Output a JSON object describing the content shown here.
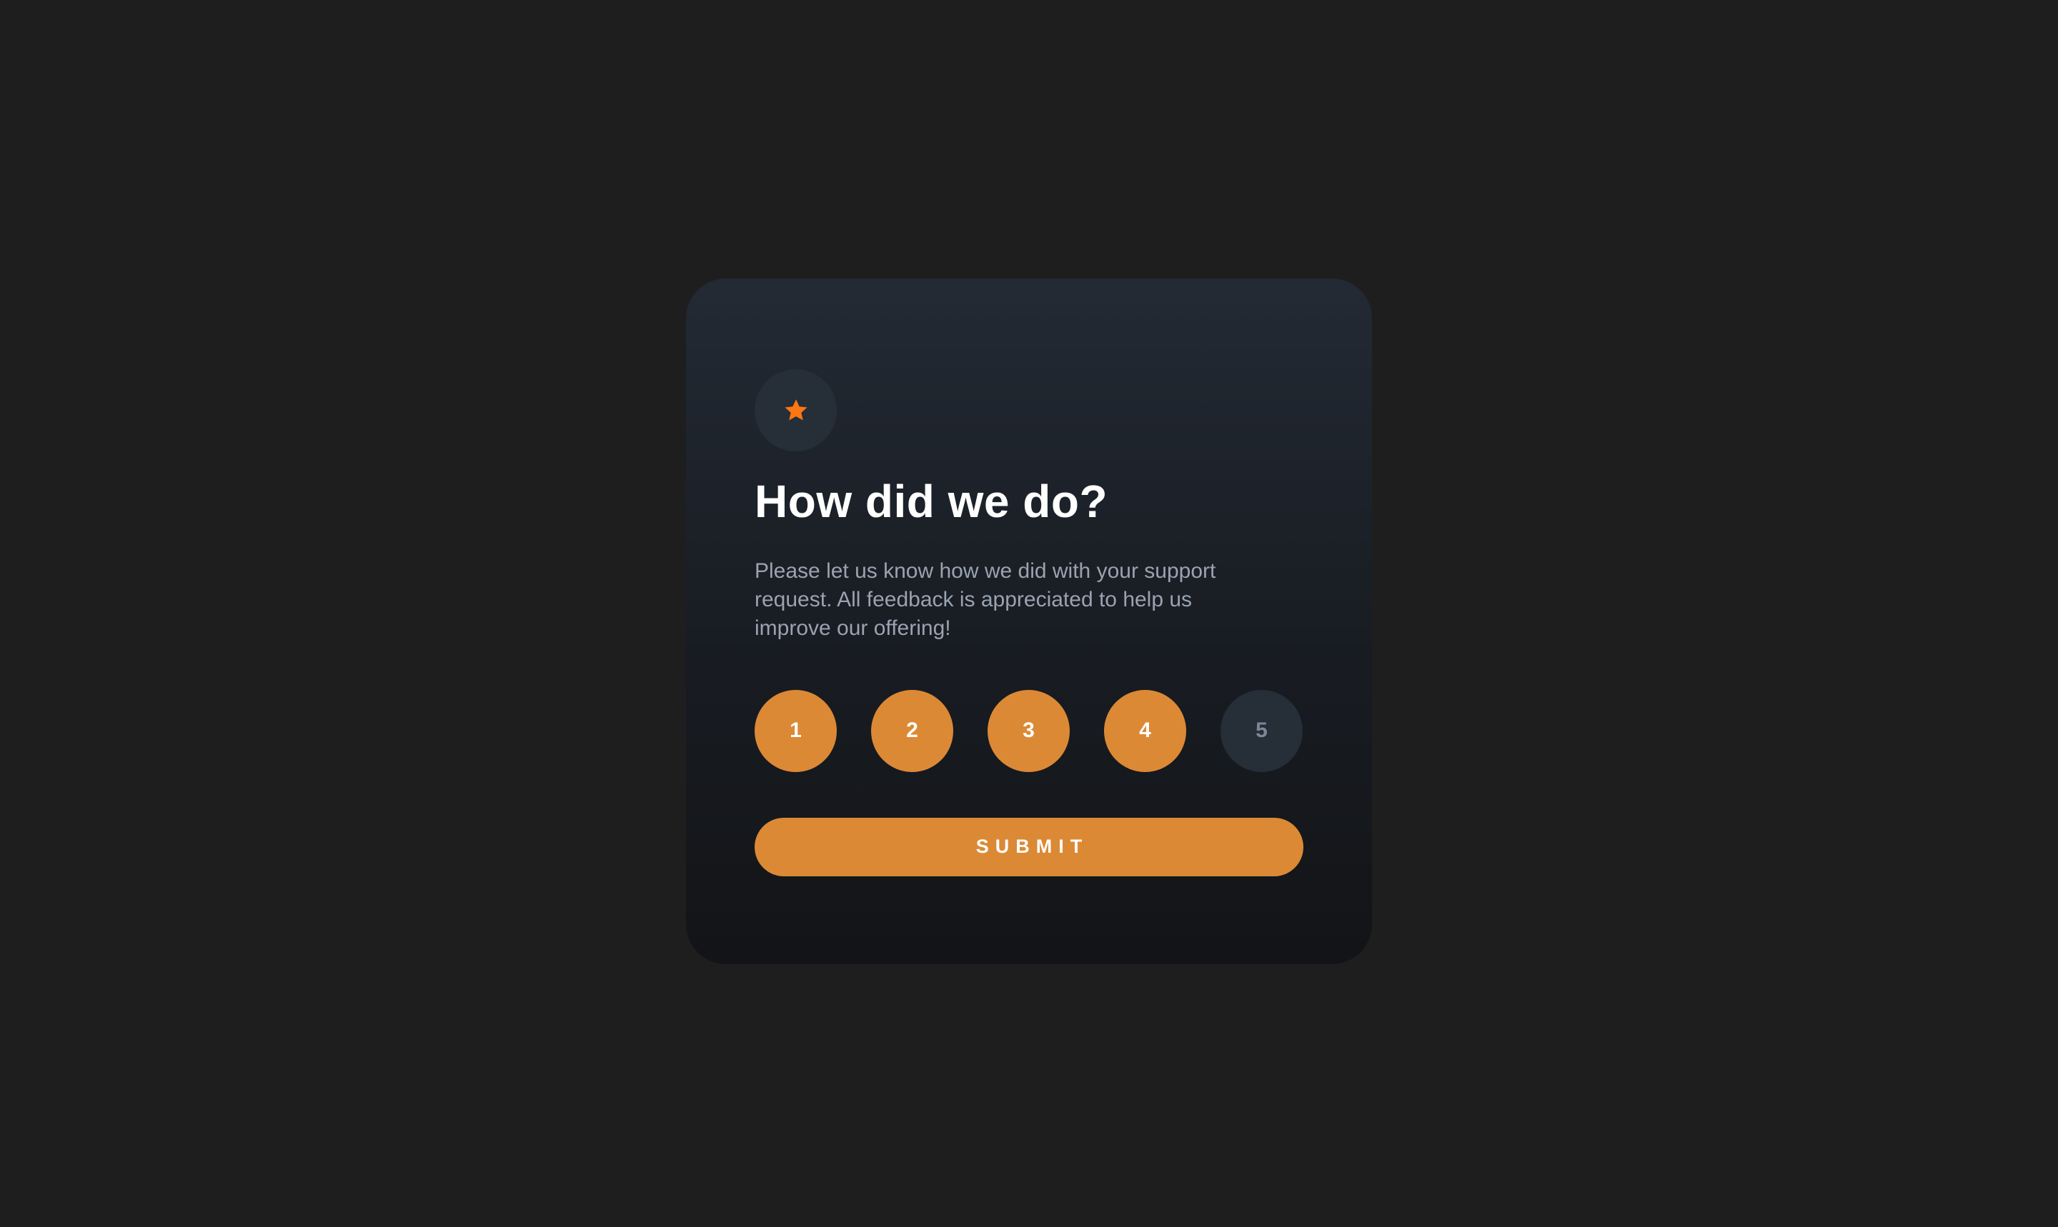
{
  "card": {
    "icon": "star-icon",
    "title": "How did we do?",
    "description": "Please let us know how we did with your support request. All feedback is appreciated to help us improve our offering!"
  },
  "ratings": [
    {
      "label": "1",
      "state": "active"
    },
    {
      "label": "2",
      "state": "active"
    },
    {
      "label": "3",
      "state": "active"
    },
    {
      "label": "4",
      "state": "active"
    },
    {
      "label": "5",
      "state": "inactive"
    }
  ],
  "submit": {
    "label": "SUBMIT"
  },
  "colors": {
    "background": "#1e1e1f",
    "accent": "#dc8935",
    "star": "#fc7614",
    "circle_inactive": "#262e38",
    "title": "#ffffff",
    "description": "#9aa3b0"
  }
}
